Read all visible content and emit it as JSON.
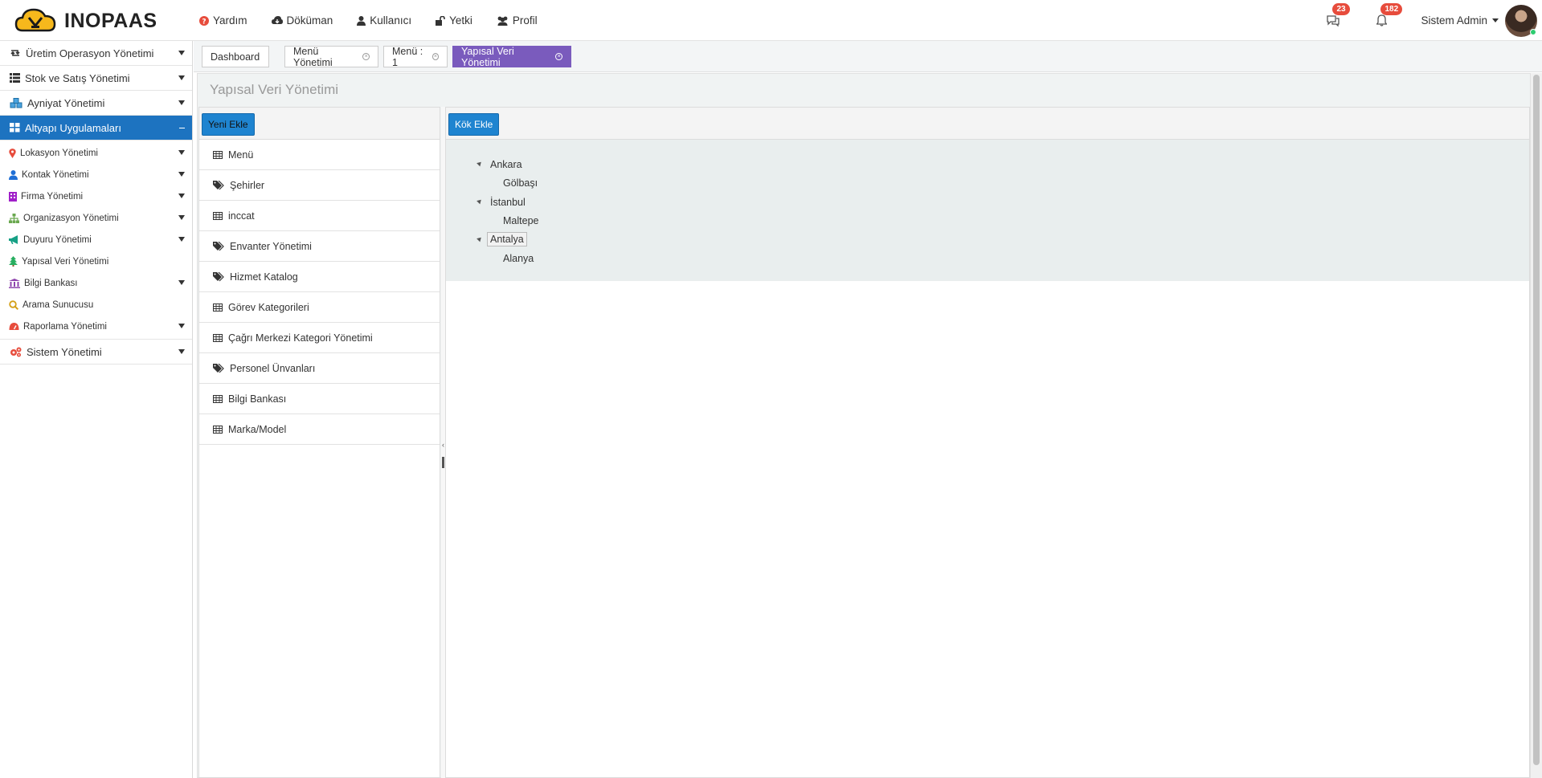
{
  "app": {
    "name": "INOPAAS"
  },
  "topnav": [
    {
      "label": "Yardım",
      "icon": "question-circle-icon",
      "color": "#e74c3c"
    },
    {
      "label": "Döküman",
      "icon": "cloud-download-icon",
      "color": "#333333"
    },
    {
      "label": "Kullanıcı",
      "icon": "user-icon",
      "color": "#333333"
    },
    {
      "label": "Yetki",
      "icon": "unlock-icon",
      "color": "#333333"
    },
    {
      "label": "Profil",
      "icon": "users-icon",
      "color": "#333333"
    }
  ],
  "notifications": {
    "messages_count": "23",
    "alerts_count": "182"
  },
  "user": {
    "name": "Sistem Admin"
  },
  "sidebar": {
    "top_items": [
      {
        "label": "Üretim Operasyon Yönetimi",
        "icon": "retweet-icon"
      },
      {
        "label": "Stok ve Satış Yönetimi",
        "icon": "list-icon"
      },
      {
        "label": "Ayniyat Yönetimi",
        "icon": "cubes-icon"
      }
    ],
    "active_item": {
      "label": "Altyapı Uygulamaları",
      "icon": "grid-icon"
    },
    "sub_items": [
      {
        "label": "Lokasyon Yönetimi",
        "icon": "map-marker-icon",
        "color": "#e74c3c",
        "expandable": true
      },
      {
        "label": "Kontak Yönetimi",
        "icon": "user-icon",
        "color": "#1f6fd6",
        "expandable": true
      },
      {
        "label": "Firma Yönetimi",
        "icon": "building-icon",
        "color": "#a020c9",
        "expandable": true
      },
      {
        "label": "Organizasyon Yönetimi",
        "icon": "sitemap-icon",
        "color": "#6aa84f",
        "expandable": true
      },
      {
        "label": "Duyuru Yönetimi",
        "icon": "bullhorn-icon",
        "color": "#16a085",
        "expandable": true
      },
      {
        "label": "Yapısal Veri Yönetimi",
        "icon": "tree-icon",
        "color": "#27ae60",
        "expandable": false
      },
      {
        "label": "Bilgi Bankası",
        "icon": "bank-icon",
        "color": "#8e44ad",
        "expandable": true
      },
      {
        "label": "Arama Sunucusu",
        "icon": "search-icon",
        "color": "#d4a017",
        "expandable": false
      },
      {
        "label": "Raporlama Yönetimi",
        "icon": "dashboard-icon",
        "color": "#e74c3c",
        "expandable": true
      }
    ],
    "bottom_item": {
      "label": "Sistem Yönetimi",
      "icon": "cogs-icon"
    }
  },
  "tabs": [
    {
      "label": "Dashboard",
      "closable": false,
      "active": false
    },
    {
      "label": "Menü Yönetimi",
      "closable": true,
      "active": false
    },
    {
      "label": "Menü : 1",
      "closable": true,
      "active": false
    },
    {
      "label": "Yapısal Veri Yönetimi",
      "closable": true,
      "active": true
    }
  ],
  "page": {
    "title": "Yapısal Veri Yönetimi"
  },
  "left_panel": {
    "add_button": "Yeni Ekle",
    "items": [
      {
        "label": "Menü",
        "icon": "table-icon"
      },
      {
        "label": "Şehirler",
        "icon": "tags-icon"
      },
      {
        "label": "inccat",
        "icon": "table-icon"
      },
      {
        "label": "Envanter Yönetimi",
        "icon": "tags-icon"
      },
      {
        "label": "Hizmet Katalog",
        "icon": "tags-icon"
      },
      {
        "label": "Görev Kategorileri",
        "icon": "table-icon"
      },
      {
        "label": "Çağrı Merkezi Kategori Yönetimi",
        "icon": "table-icon"
      },
      {
        "label": "Personel Ünvanları",
        "icon": "tags-icon"
      },
      {
        "label": "Bilgi Bankası",
        "icon": "table-icon"
      },
      {
        "label": "Marka/Model",
        "icon": "table-icon"
      }
    ]
  },
  "right_panel": {
    "add_root_button": "Kök Ekle",
    "tree": [
      {
        "label": "Ankara",
        "children": [
          "Gölbaşı"
        ],
        "selected": false
      },
      {
        "label": "İstanbul",
        "children": [
          "Maltepe"
        ],
        "selected": false
      },
      {
        "label": "Antalya",
        "children": [
          "Alanya"
        ],
        "selected": true
      }
    ]
  },
  "colors": {
    "accent": "#1d73c0",
    "active_tab": "#7a5bbd",
    "badge": "#e74c3c",
    "button": "#1f84d0"
  }
}
